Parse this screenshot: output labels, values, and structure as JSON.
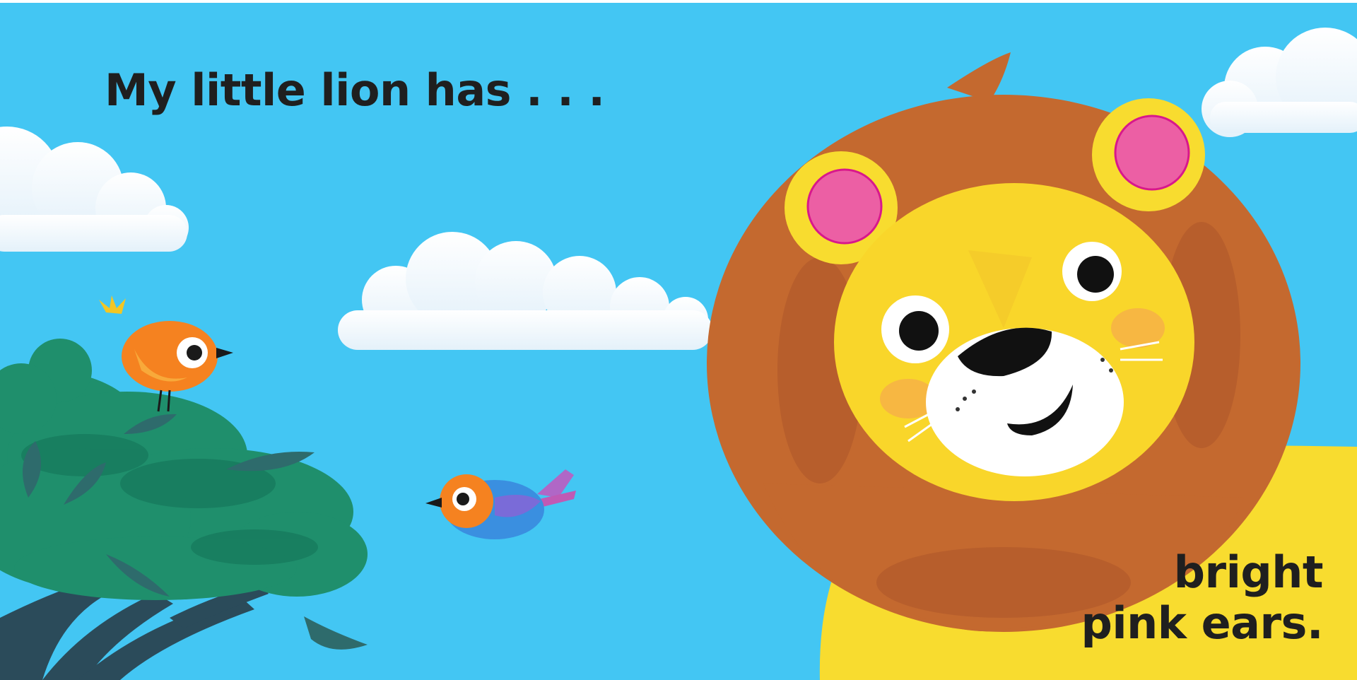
{
  "page": {
    "left_text": "My little lion has . . .",
    "right_text_line1": "bright",
    "right_text_line2": "pink ears."
  },
  "illustration": {
    "subjects": [
      "lion",
      "orange-bird",
      "blue-bird",
      "tree",
      "clouds"
    ]
  },
  "colors": {
    "sky": "#43c6f3",
    "cloud": "#ffffff",
    "mane": "#c4692f",
    "lion_face": "#f9d62a",
    "lion_body": "#f8dc2f",
    "ear_inner": "#ec5fa4",
    "muzzle": "#ffffff",
    "tree_leaves": "#1c8d6a",
    "tree_trunk": "#2b4b5a",
    "orange_bird": "#f58220",
    "blue_bird": "#3a8fe0",
    "text": "#1f1f1f"
  }
}
